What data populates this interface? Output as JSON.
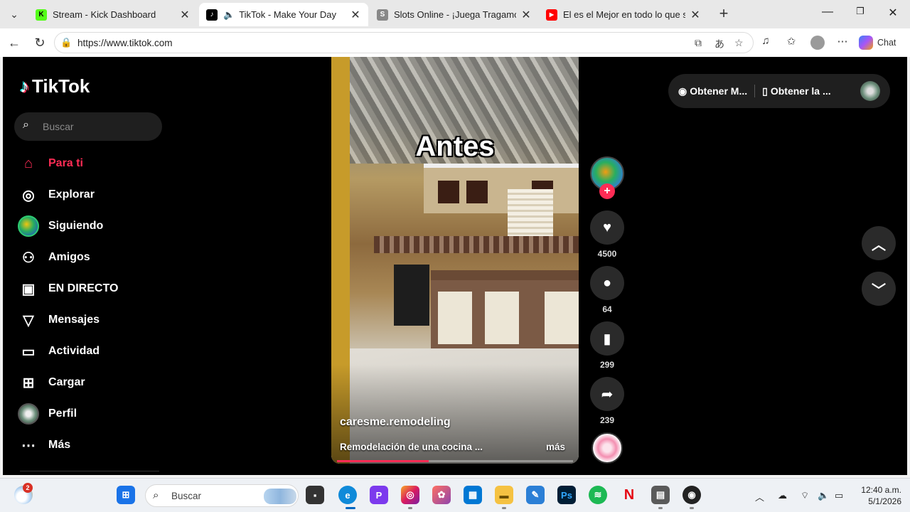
{
  "browser": {
    "tabs": [
      {
        "title": "Stream - Kick Dashboard",
        "fav_color": "#53fc18",
        "fav_text": "K"
      },
      {
        "title": "TikTok - Make Your Day",
        "fav_color": "#000000",
        "fav_text": "♪",
        "active": true
      },
      {
        "title": "Slots Online - ¡Juega Tragamonedas",
        "fav_color": "#888888",
        "fav_text": "S"
      },
      {
        "title": "El es el Mejor en todo lo que se lla",
        "fav_color": "#ff0000",
        "fav_text": "▶"
      }
    ],
    "url": "https://www.tiktok.com",
    "chat_label": "Chat"
  },
  "tiktok": {
    "logo": "TikTok",
    "search_placeholder": "Buscar",
    "nav": [
      {
        "label": "Para ti",
        "icon": "home-icon"
      },
      {
        "label": "Explorar",
        "icon": "compass-icon"
      },
      {
        "label": "Siguiendo",
        "icon": "avatar"
      },
      {
        "label": "Amigos",
        "icon": "friends-icon"
      },
      {
        "label": "EN DIRECTO",
        "icon": "live-icon"
      },
      {
        "label": "Mensajes",
        "icon": "messages-icon"
      },
      {
        "label": "Actividad",
        "icon": "activity-icon"
      },
      {
        "label": "Cargar",
        "icon": "upload-icon"
      },
      {
        "label": "Perfil",
        "icon": "avatar"
      },
      {
        "label": "Más",
        "icon": "more-icon"
      }
    ],
    "video": {
      "overlay_text": "Antes",
      "author": "caresme.remodeling",
      "description": "Remodelación de una cocina ...",
      "more_label": "más",
      "progress": 0.39
    },
    "actions": {
      "likes": "4500",
      "comments": "64",
      "saves": "299",
      "shares": "239"
    },
    "top_right": {
      "get_app_1": "Obtener M...",
      "get_app_2": "Obtener la ..."
    }
  },
  "taskbar": {
    "search_placeholder": "Buscar",
    "weather_badge": "2",
    "time": "12:40 a.m.",
    "date": "5/1/2026"
  }
}
